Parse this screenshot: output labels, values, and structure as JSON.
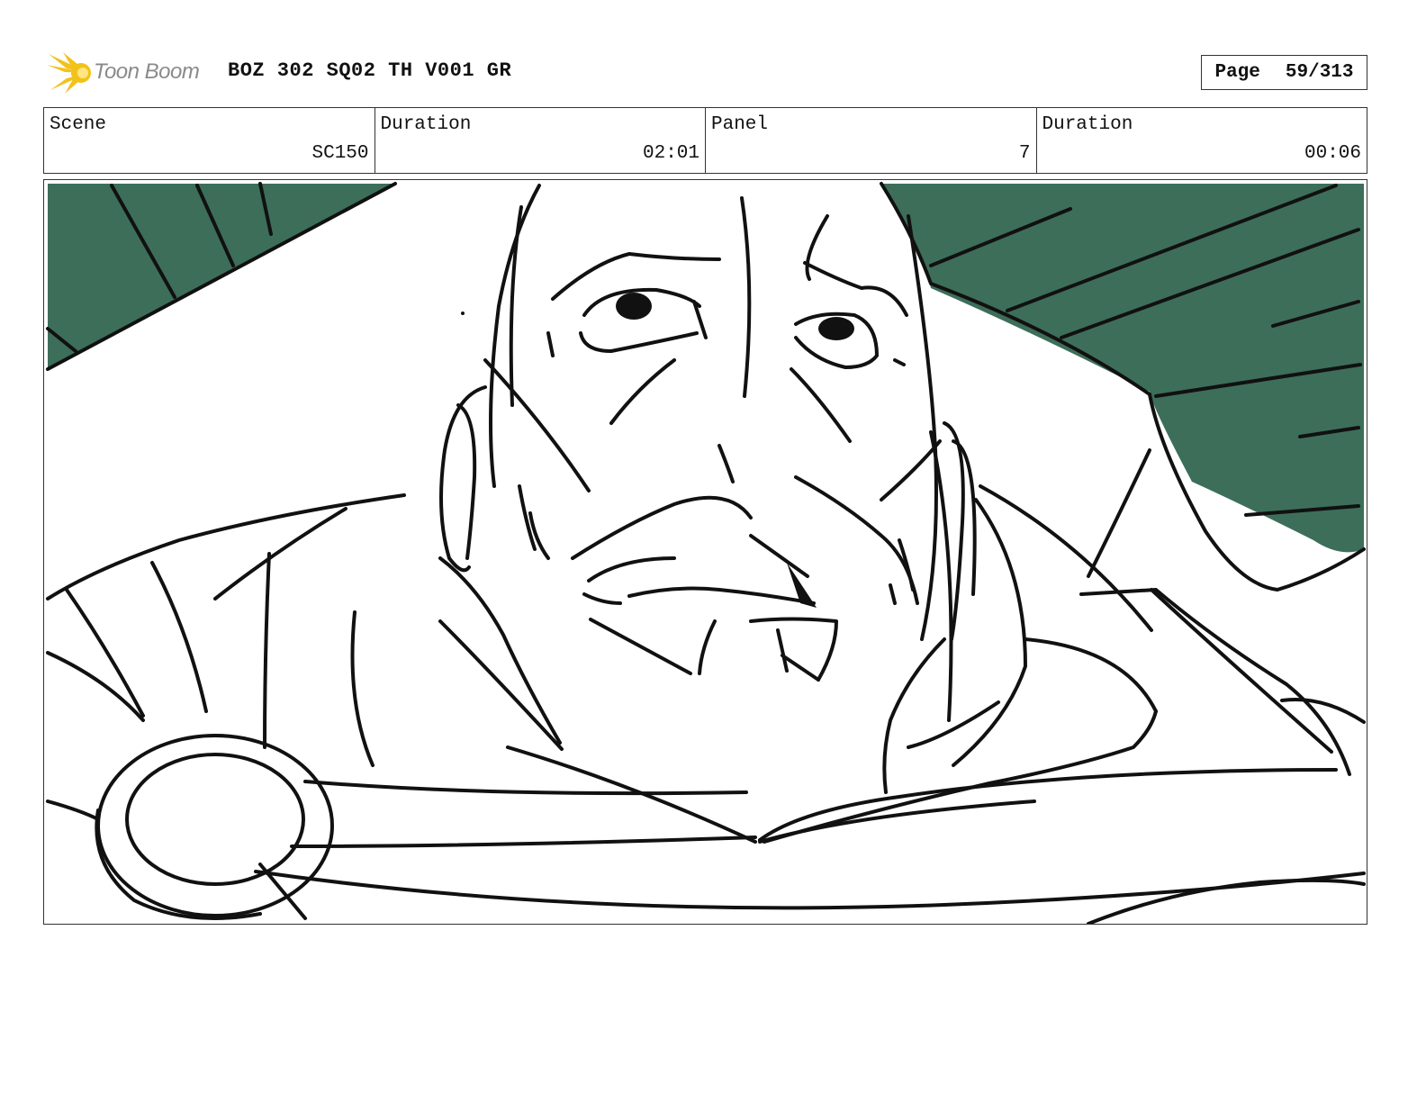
{
  "header": {
    "logo_text": "Toon Boom",
    "title": "BOZ 302 SQ02 TH V001 GR",
    "page_label": "Page",
    "page_value": "59/313"
  },
  "info": {
    "scene_label": "Scene",
    "scene_value": "SC150",
    "duration_label": "Duration",
    "duration_value": "02:01",
    "panel_label": "Panel",
    "panel_value": "7",
    "panel_duration_label": "Duration",
    "panel_duration_value": "00:06"
  },
  "colors": {
    "background_green": "#3d6e5a",
    "logo_yellow": "#f2c21b",
    "ink": "#111111"
  },
  "icons": {
    "logo": "toon-boom-starburst-icon"
  }
}
